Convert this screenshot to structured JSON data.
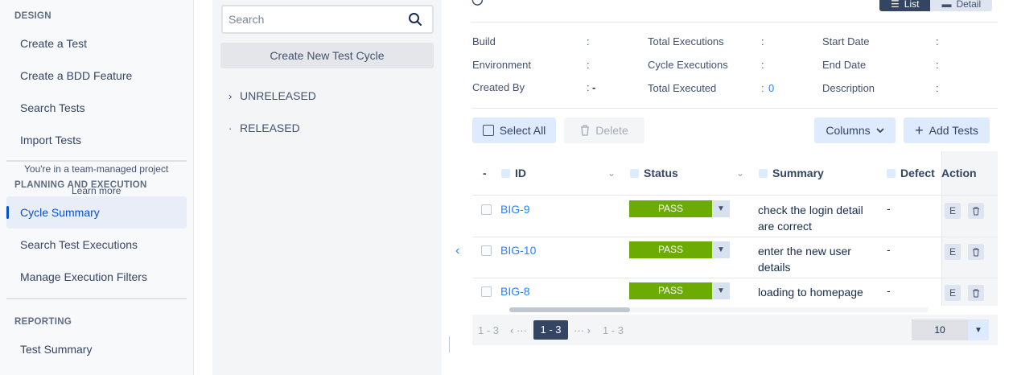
{
  "sidebar": {
    "design_heading": "DESIGN",
    "design_items": [
      "Create a Test",
      "Create a BDD Feature",
      "Search Tests",
      "Import Tests"
    ],
    "team_note": "You're in a team-managed project",
    "learn_more": "Learn more",
    "planning_heading": "PLANNING AND EXECUTION",
    "planning_items": [
      "Cycle Summary",
      "Search Test Executions",
      "Manage Execution Filters"
    ],
    "reporting_heading": "REPORTING",
    "reporting_items": [
      "Test Summary"
    ]
  },
  "tree": {
    "search_placeholder": "Search",
    "new_cycle_label": "Create New Test Cycle",
    "nodes": [
      "UNRELEASED",
      "RELEASED"
    ]
  },
  "view_toggle": {
    "list": "List",
    "detail": "Detail"
  },
  "cycle_info": {
    "col1": [
      {
        "label": "Build",
        "value": ""
      },
      {
        "label": "Environment",
        "value": ""
      },
      {
        "label": "Created By",
        "value": "-"
      }
    ],
    "col2": [
      {
        "label": "Total Executions",
        "value": ""
      },
      {
        "label": "Cycle Executions",
        "value": ""
      },
      {
        "label": "Total Executed",
        "value": "0"
      }
    ],
    "col3": [
      {
        "label": "Start Date",
        "value": ""
      },
      {
        "label": "End Date",
        "value": ""
      },
      {
        "label": "Description",
        "value": ""
      }
    ]
  },
  "toolbar": {
    "select_all": "Select All",
    "delete": "Delete",
    "columns": "Columns",
    "add_tests": "Add Tests"
  },
  "table": {
    "headers": {
      "bulk": "-",
      "id": "ID",
      "status": "Status",
      "summary": "Summary",
      "defect": "Defect",
      "action": "Action"
    },
    "rows": [
      {
        "id": "BIG-9",
        "status": "PASS",
        "summary": "check the login detail are correct",
        "defect": "-"
      },
      {
        "id": "BIG-10",
        "status": "PASS",
        "summary": "enter the new user details",
        "defect": "-"
      },
      {
        "id": "BIG-8",
        "status": "PASS",
        "summary": "loading to homepage",
        "defect": "-"
      }
    ],
    "action_e": "E"
  },
  "pager": {
    "left_range": "1 - 3",
    "current": "1 - 3",
    "right_range": "1 - 3",
    "page_size": "10"
  },
  "colors": {
    "accent": "#0052cc",
    "pass": "#6bab03",
    "link": "#2684ff"
  }
}
